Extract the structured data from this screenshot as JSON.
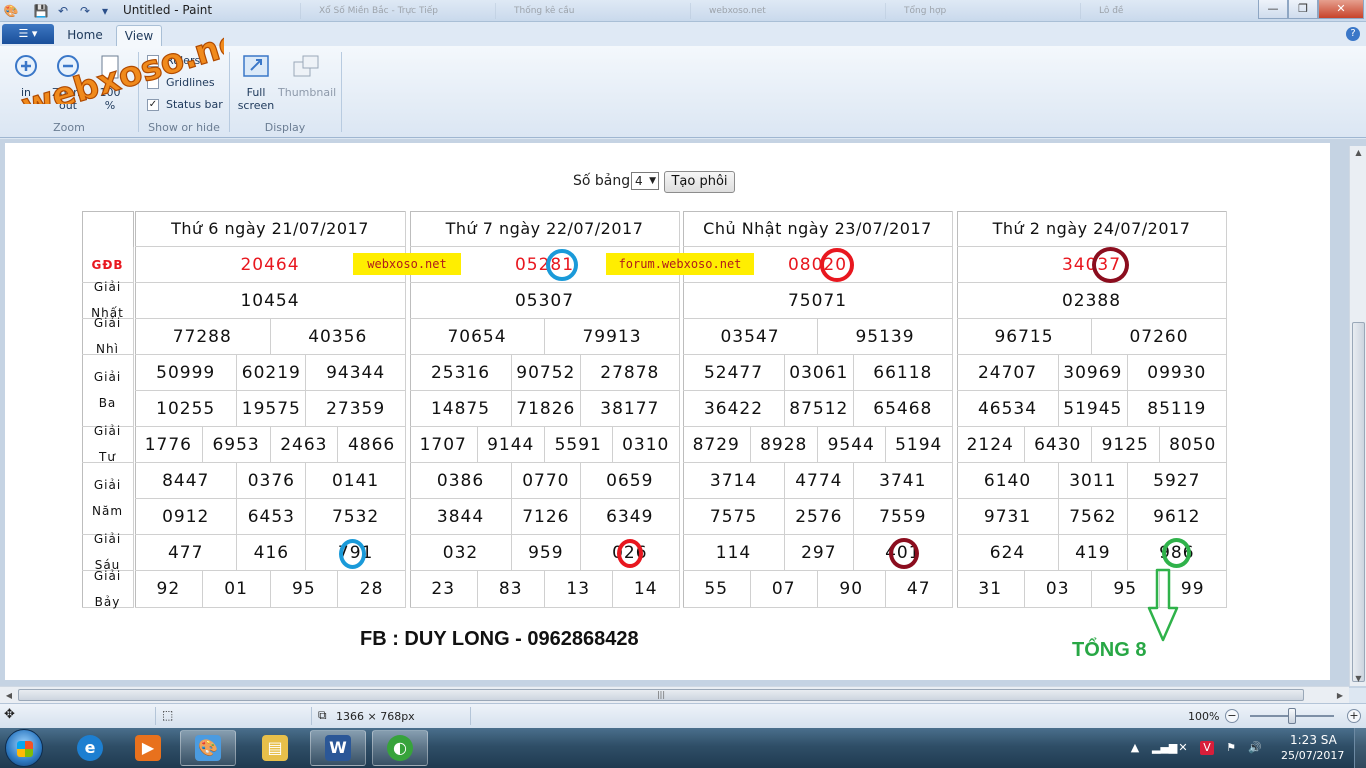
{
  "window": {
    "title": "Untitled - Paint",
    "help": "?",
    "min": "—",
    "max": "❐",
    "close": "✕"
  },
  "ghost_tabs": [
    "Xổ Số Miền Bắc - Trực Tiếp",
    "Thống kê cầu",
    "webxoso.net",
    "Tổng hợp",
    "Lô đề"
  ],
  "ribbon": {
    "app_menu": "☰ ▾",
    "tabs": [
      "Home",
      "View"
    ],
    "zoom_in": "in",
    "zoom_out_l1": "Zoom",
    "zoom_out_l2": "out",
    "zoom100_l1": "100",
    "zoom100_l2": "%",
    "group_zoom": "Zoom",
    "rulers": "Rulers",
    "gridlines": "Gridlines",
    "statusbar": "Status bar",
    "group_show": "Show or hide",
    "full_l1": "Full",
    "full_l2": "screen",
    "thumbnail": "Thumbnail",
    "group_display": "Display"
  },
  "logo_text": "webxoso.net",
  "form": {
    "label": "Số bảng",
    "select_value": "4",
    "button": "Tạo phôi"
  },
  "prize_labels": [
    [
      "GĐB"
    ],
    [
      "Giải",
      "Nhất"
    ],
    [
      "Giải",
      "Nhì"
    ],
    [
      "Giải",
      "Ba"
    ],
    [
      "Giải",
      "Tư"
    ],
    [
      "Giải",
      "Năm"
    ],
    [
      "Giải",
      "Sáu"
    ],
    [
      "Giải",
      "Bảy"
    ]
  ],
  "days": [
    {
      "header": "Thứ 6 ngày 21/07/2017",
      "gdb": "20464",
      "nhat": "10454",
      "nhi": [
        "77288",
        "40356"
      ],
      "ba1": [
        "50999",
        "60219",
        "94344"
      ],
      "ba2": [
        "10255",
        "19575",
        "27359"
      ],
      "tu": [
        "1776",
        "6953",
        "2463",
        "4866"
      ],
      "nam1": [
        "8447",
        "0376",
        "0141"
      ],
      "nam2": [
        "0912",
        "6453",
        "7532"
      ],
      "sau": [
        "477",
        "416",
        "791"
      ],
      "bay": [
        "92",
        "01",
        "95",
        "28"
      ]
    },
    {
      "header": "Thứ 7 ngày 22/07/2017",
      "gdb": "05281",
      "nhat": "05307",
      "nhi": [
        "70654",
        "79913"
      ],
      "ba1": [
        "25316",
        "90752",
        "27878"
      ],
      "ba2": [
        "14875",
        "71826",
        "38177"
      ],
      "tu": [
        "1707",
        "9144",
        "5591",
        "0310"
      ],
      "nam1": [
        "0386",
        "0770",
        "0659"
      ],
      "nam2": [
        "3844",
        "7126",
        "6349"
      ],
      "sau": [
        "032",
        "959",
        "026"
      ],
      "bay": [
        "23",
        "83",
        "13",
        "14"
      ]
    },
    {
      "header": "Chủ Nhật ngày 23/07/2017",
      "gdb": "08020",
      "nhat": "75071",
      "nhi": [
        "03547",
        "95139"
      ],
      "ba1": [
        "52477",
        "03061",
        "66118"
      ],
      "ba2": [
        "36422",
        "87512",
        "65468"
      ],
      "tu": [
        "8729",
        "8928",
        "9544",
        "5194"
      ],
      "nam1": [
        "3714",
        "4774",
        "3741"
      ],
      "nam2": [
        "7575",
        "2576",
        "7559"
      ],
      "sau": [
        "114",
        "297",
        "401"
      ],
      "bay": [
        "55",
        "07",
        "90",
        "47"
      ]
    },
    {
      "header": "Thứ 2 ngày 24/07/2017",
      "gdb": "34037",
      "nhat": "02388",
      "nhi": [
        "96715",
        "07260"
      ],
      "ba1": [
        "24707",
        "30969",
        "09930"
      ],
      "ba2": [
        "46534",
        "51945",
        "85119"
      ],
      "tu": [
        "2124",
        "6430",
        "9125",
        "8050"
      ],
      "nam1": [
        "6140",
        "3011",
        "5927"
      ],
      "nam2": [
        "9731",
        "7562",
        "9612"
      ],
      "sau": [
        "624",
        "419",
        "986"
      ],
      "bay": [
        "31",
        "03",
        "95",
        "99"
      ]
    }
  ],
  "watermarks": [
    "webxoso.net",
    "forum.webxoso.net"
  ],
  "annotations": {
    "fb": "FB : DUY LONG - 0962868428",
    "tong": "TỔNG 8",
    "colors": {
      "blue": "#1a9ad9",
      "red": "#e8171f",
      "maroon": "#8b0d1e",
      "green": "#2fb24a"
    }
  },
  "statusbar": {
    "size": "1366 × 768px",
    "zoom": "100%"
  },
  "taskbar": {
    "apps": [
      "internet-explorer",
      "media-player",
      "paint",
      "file-explorer",
      "word",
      "coccoc-browser"
    ],
    "time": "1:23 SA",
    "date": "25/07/2017"
  }
}
